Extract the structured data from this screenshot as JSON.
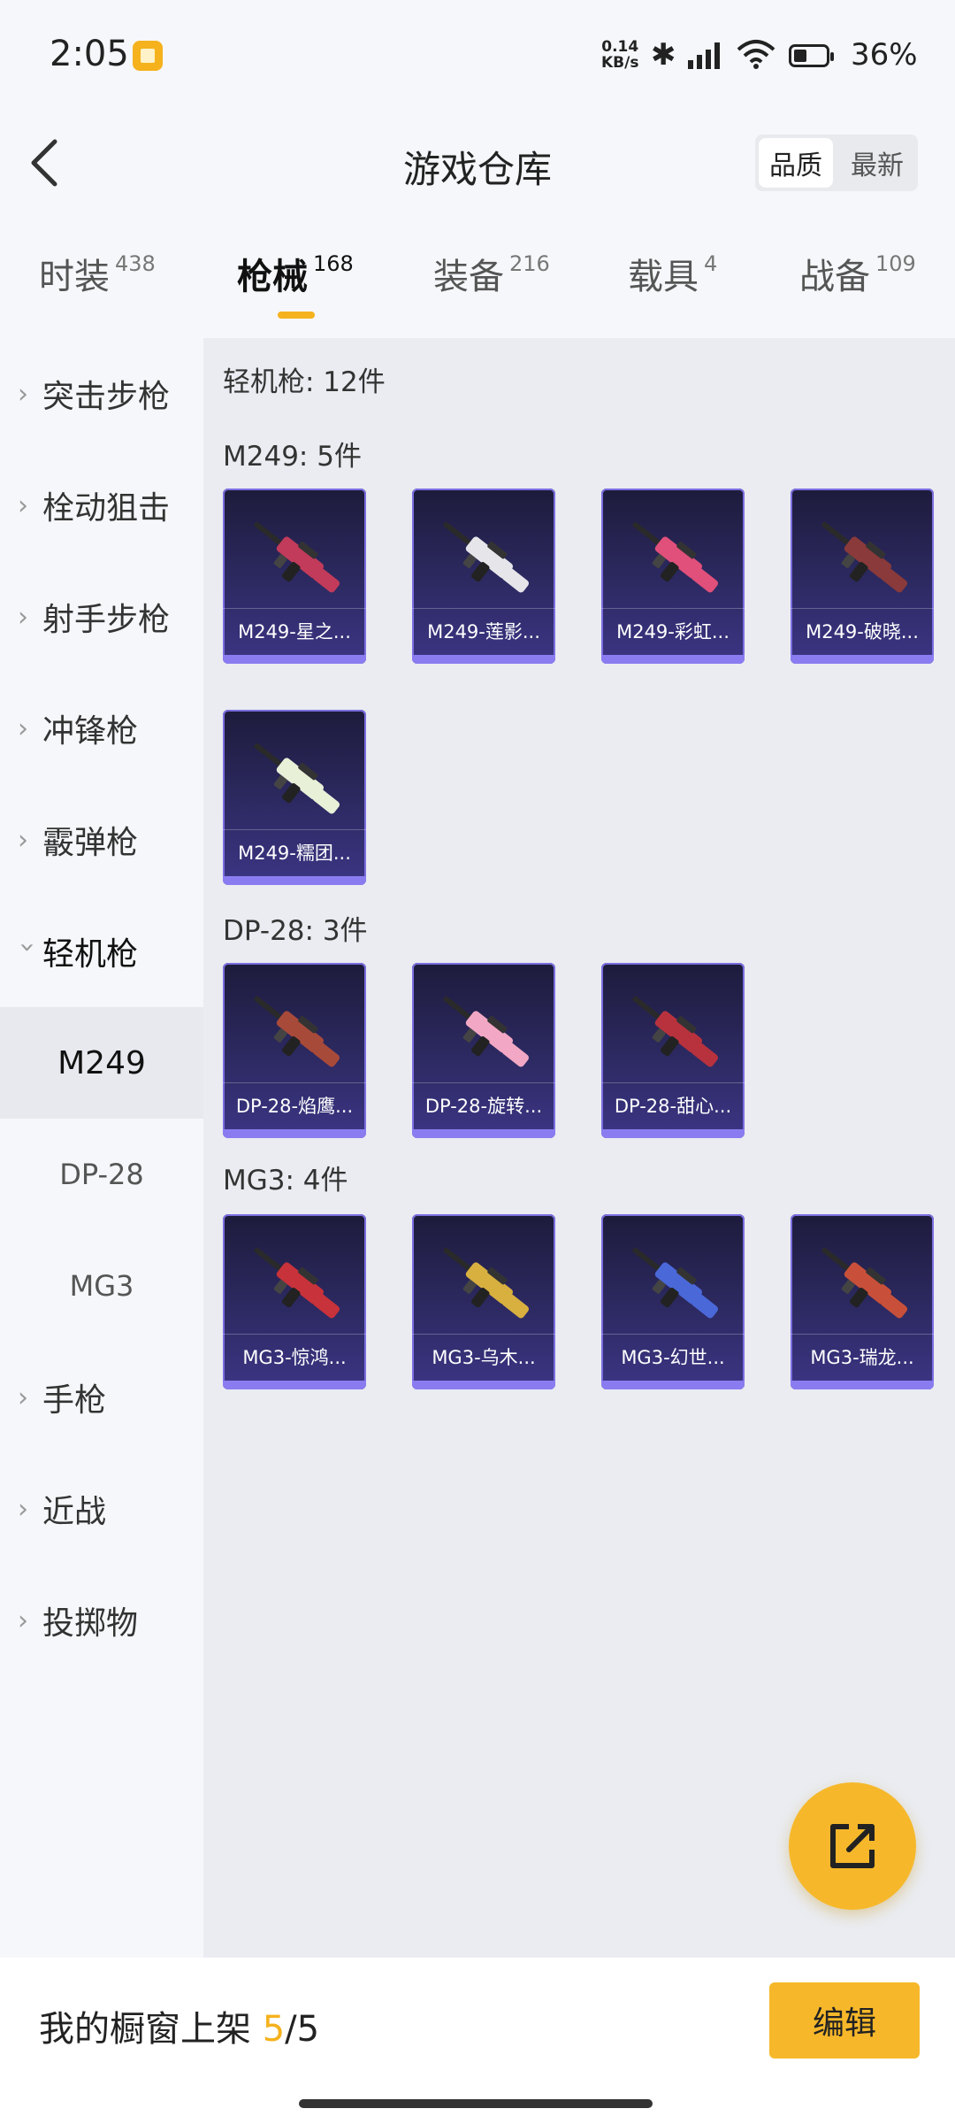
{
  "status_bar": {
    "time": "2:05",
    "speed_top": "0.14",
    "speed_bottom": "KB/s",
    "battery": "36%"
  },
  "header": {
    "title": "游戏仓库",
    "sort_options": [
      "品质",
      "最新"
    ],
    "sort_selected": "品质"
  },
  "tabs": [
    {
      "label": "时装",
      "count": "438"
    },
    {
      "label": "枪械",
      "count": "168"
    },
    {
      "label": "装备",
      "count": "216"
    },
    {
      "label": "载具",
      "count": "4"
    },
    {
      "label": "战备",
      "count": "109"
    }
  ],
  "active_tab": "枪械",
  "sidebar": [
    {
      "label": "突击步枪"
    },
    {
      "label": "栓动狙击"
    },
    {
      "label": "射手步枪"
    },
    {
      "label": "冲锋枪"
    },
    {
      "label": "霰弹枪"
    },
    {
      "label": "轻机枪"
    },
    {
      "label": "M249"
    },
    {
      "label": "DP-28"
    },
    {
      "label": "MG3"
    },
    {
      "label": "手枪"
    },
    {
      "label": "近战"
    },
    {
      "label": "投掷物"
    }
  ],
  "content": {
    "category_total": "轻机枪: 12件",
    "groups": [
      {
        "title": "M249: 5件",
        "items": [
          {
            "name": "M249-星之...",
            "color": "#c23b5a"
          },
          {
            "name": "M249-莲影...",
            "color": "#e6e6ea"
          },
          {
            "name": "M249-彩虹...",
            "color": "#e0507a"
          },
          {
            "name": "M249-破晓...",
            "color": "#8a3a3a"
          },
          {
            "name": "M249-糯团...",
            "color": "#e8f0d8"
          }
        ]
      },
      {
        "title": "DP-28: 3件",
        "items": [
          {
            "name": "DP-28-焰鹰...",
            "color": "#a84a3a"
          },
          {
            "name": "DP-28-旋转...",
            "color": "#f2a8c4"
          },
          {
            "name": "DP-28-甜心...",
            "color": "#b8323e"
          }
        ]
      },
      {
        "title": "MG3: 4件",
        "items": [
          {
            "name": "MG3-惊鸿...",
            "color": "#c8323a"
          },
          {
            "name": "MG3-乌木...",
            "color": "#d8b040"
          },
          {
            "name": "MG3-幻世...",
            "color": "#4a68d8"
          },
          {
            "name": "MG3-瑞龙...",
            "color": "#c8503a"
          }
        ]
      }
    ]
  },
  "bottom_bar": {
    "shelf_label": "我的橱窗上架",
    "shelf_count": "5",
    "shelf_total": "/5",
    "edit_label": "编辑"
  },
  "colors": {
    "accent": "#f6b82a",
    "card_bg": "#2d2a63",
    "card_border": "#7a6ee0"
  }
}
